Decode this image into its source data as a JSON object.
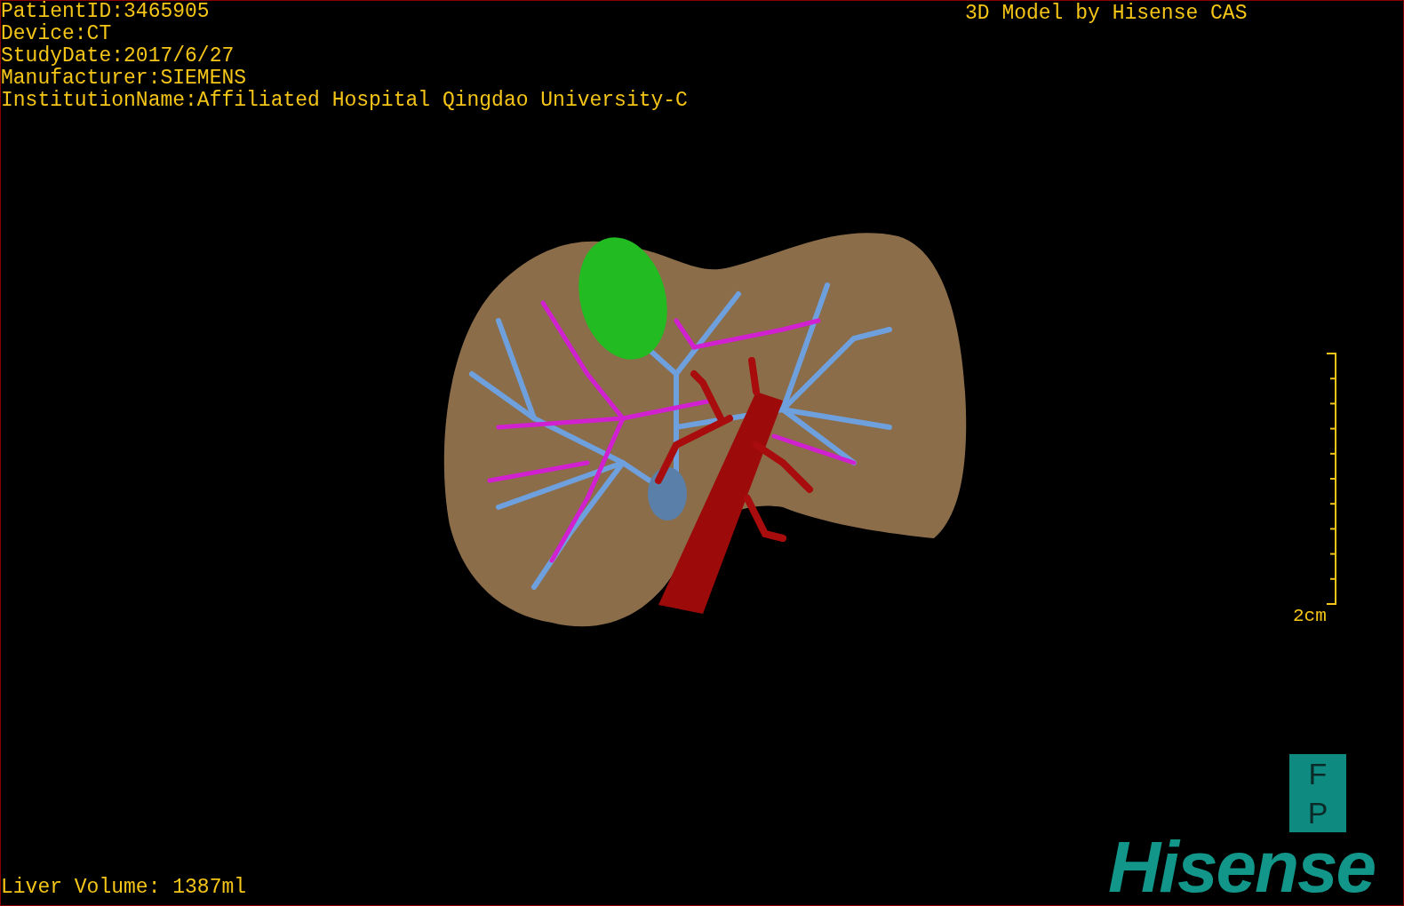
{
  "patient_info": [
    "PatientID:3465905",
    "Device:CT",
    "StudyDate:2017/6/27",
    "Manufacturer:SIEMENS",
    "InstitutionName:Affiliated Hospital Qingdao University-C"
  ],
  "title": "3D Model by Hisense CAS",
  "scale_bar": {
    "label": "2cm"
  },
  "orientation_cube": {
    "top": "F",
    "bottom": "P"
  },
  "logo": "Hisense",
  "liver_volume": "Liver Volume: 1387ml"
}
